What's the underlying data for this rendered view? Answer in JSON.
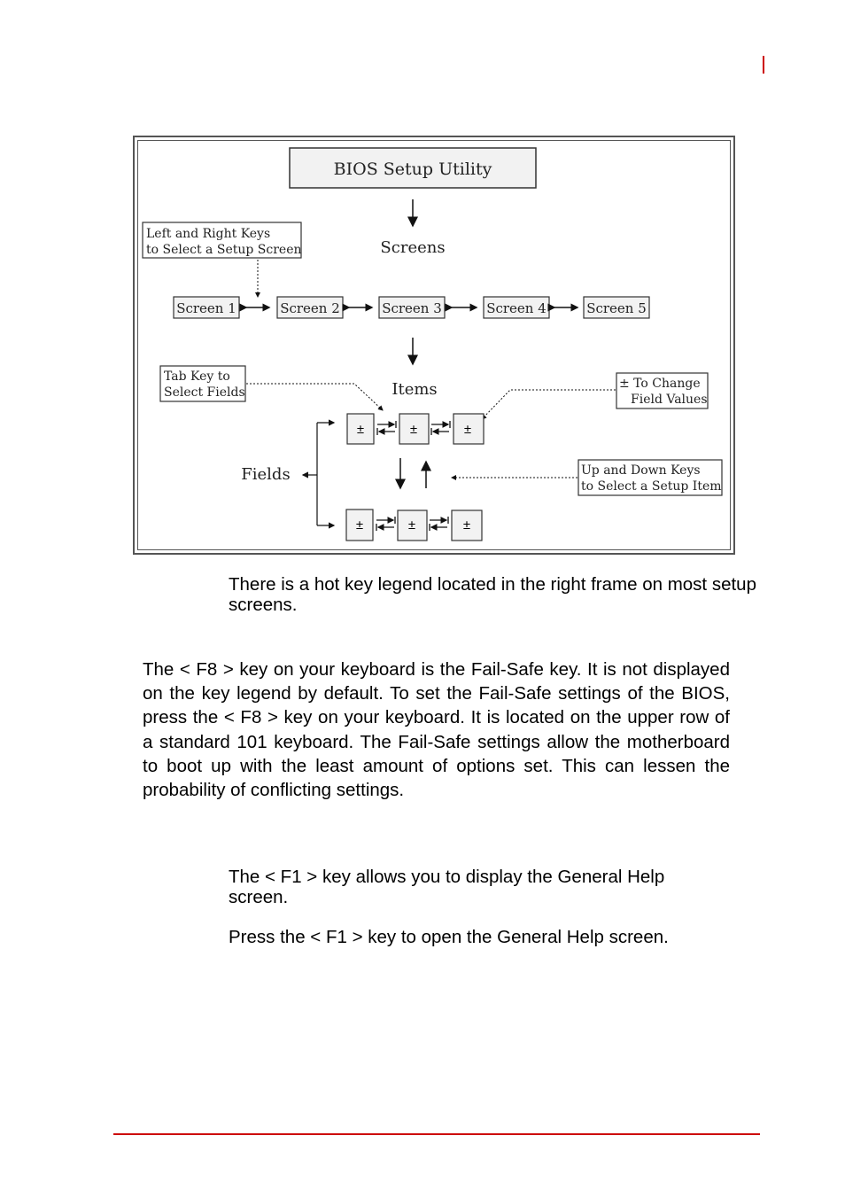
{
  "header": {
    "page_marker_color": "#cc0000"
  },
  "diagram": {
    "title": "BIOS Setup Utility",
    "screens_label": "Screens",
    "items_label": "Items",
    "fields_label": "Fields",
    "screens": [
      "Screen 1",
      "Screen 2",
      "Screen 3",
      "Screen 4",
      "Screen 5"
    ],
    "field_symbol": "±",
    "callouts": {
      "left_right": [
        "Left and Right Keys",
        "to Select a Setup Screen"
      ],
      "tab_key": [
        "Tab Key to",
        "Select Fields"
      ],
      "change_values": [
        "± To Change",
        "Field Values"
      ],
      "up_down": [
        "Up and Down Keys",
        "to Select a Setup Item"
      ]
    }
  },
  "content": {
    "hotkey_note": "There is a hot key legend located in the right frame on most setup screens.",
    "f8_paragraph": "The < F8 > key on your keyboard is the Fail-Safe key. It is not displayed on the key legend by default. To set the Fail-Safe settings of the BIOS, press the < F8 > key on your keyboard. It is located on the upper row of a standard 101 keyboard. The Fail-Safe settings allow the motherboard to boot up with the least amount of options set. This can lessen the probability of conflicting settings.",
    "f1_description": "The < F1 > key allows you to display the General Help screen.",
    "f1_instruction": "Press the < F1 > key to open the General Help screen."
  },
  "footer": {
    "rule_color": "#cc0000"
  }
}
